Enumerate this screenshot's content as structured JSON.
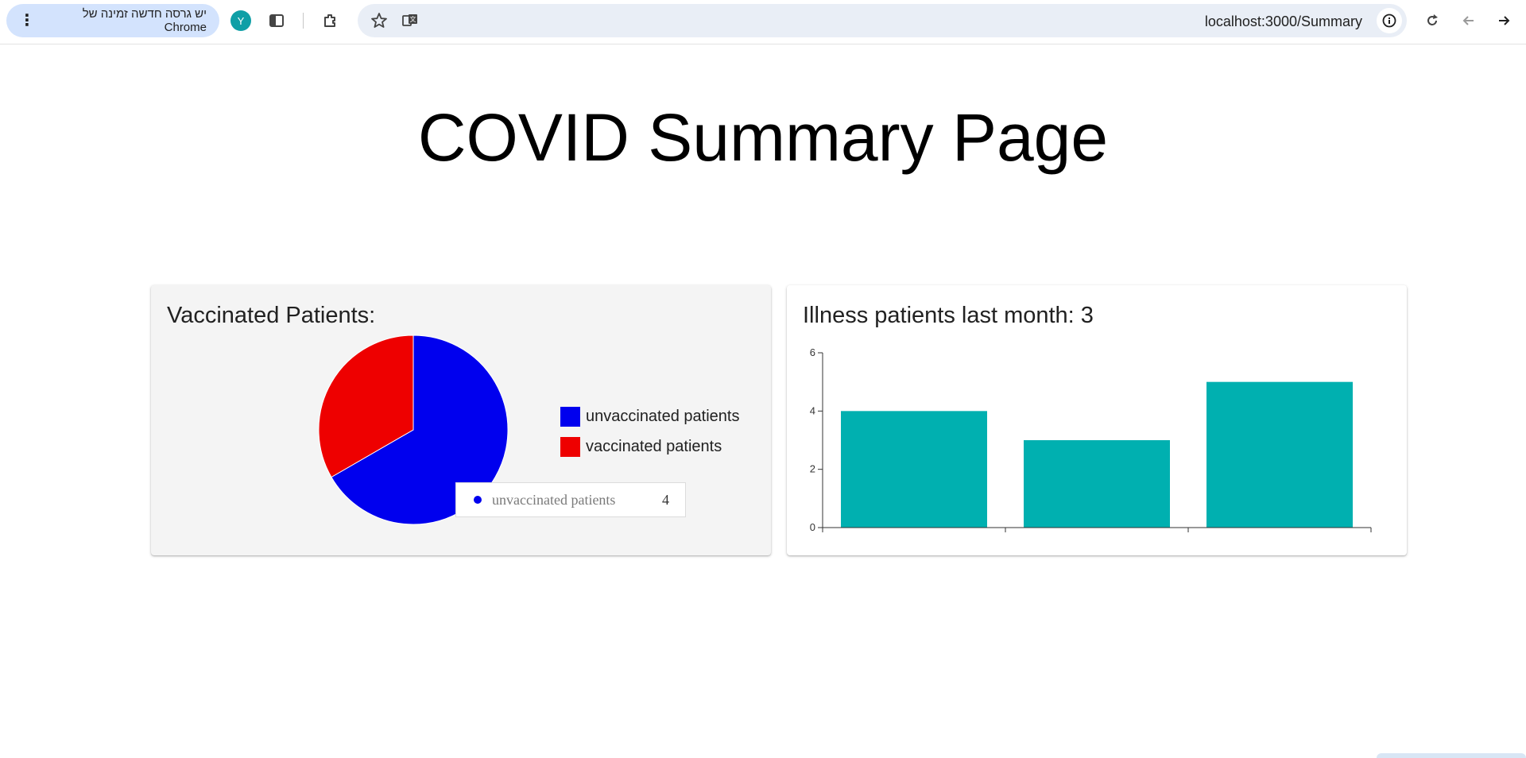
{
  "browser": {
    "update_text": "יש גרסה חדשה זמינה של Chrome",
    "profile_initial": "Y",
    "url": "localhost:3000/Summary"
  },
  "page": {
    "title": "COVID Summary Page"
  },
  "vaccinated_card": {
    "title": "Vaccinated Patients:",
    "tooltip": {
      "label": "unvaccinated patients",
      "value": "4"
    }
  },
  "illness_card": {
    "title": "Illness patients last month: 3"
  },
  "chart_data": [
    {
      "type": "pie",
      "title": "Vaccinated Patients:",
      "slices": [
        {
          "name": "unvaccinated patients",
          "value": 4,
          "color": "#0000ee"
        },
        {
          "name": "vaccinated patients",
          "value": 2,
          "color": "#ee0000"
        }
      ],
      "legend": "right"
    },
    {
      "type": "bar",
      "title": "Illness patients last month: 3",
      "categories": [
        "",
        "",
        ""
      ],
      "values": [
        4,
        3,
        5
      ],
      "ylim": [
        0,
        6
      ],
      "yticks": [
        "0",
        "2",
        "4",
        "6"
      ],
      "color": "#00b0b0",
      "grid": false
    }
  ]
}
